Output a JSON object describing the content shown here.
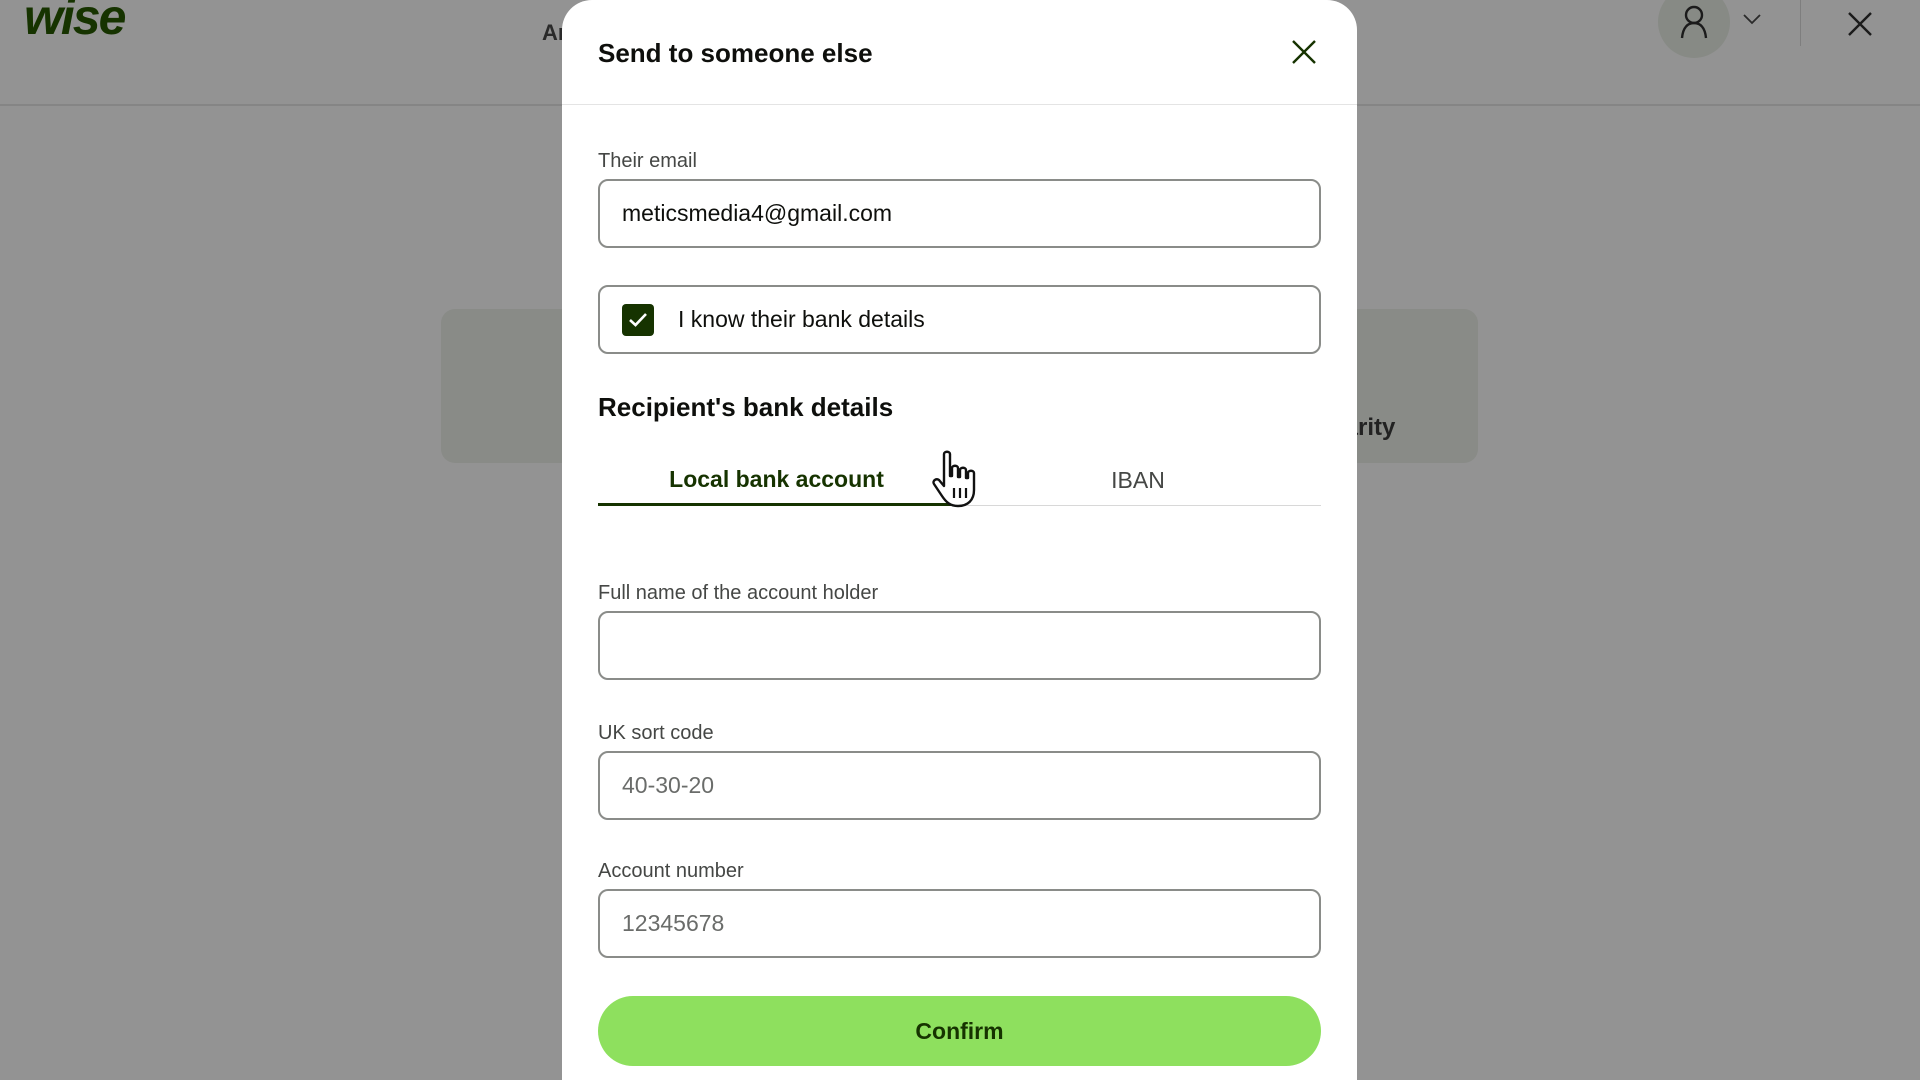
{
  "background": {
    "logo": "wise",
    "nav_partial": "Ar",
    "card_partial": "harity",
    "icons": [
      "user-icon",
      "chevron-down-icon",
      "close-icon"
    ]
  },
  "modal": {
    "title": "Send to someone else",
    "email": {
      "label": "Their email",
      "value": "meticsmedia4@gmail.com"
    },
    "bank_checkbox": {
      "label": "I know their bank details",
      "checked": true
    },
    "section_title": "Recipient's bank details",
    "tabs": [
      {
        "label": "Local bank account",
        "active": true
      },
      {
        "label": "IBAN",
        "active": false
      }
    ],
    "full_name": {
      "label": "Full name of the account holder",
      "value": "",
      "placeholder": ""
    },
    "sort_code": {
      "label": "UK sort code",
      "placeholder": "40-30-20"
    },
    "account_number": {
      "label": "Account number",
      "placeholder": "12345678"
    },
    "confirm_label": "Confirm"
  },
  "colors": {
    "accent": "#9fe870",
    "brand_dark": "#163300",
    "overlay": "#939393"
  }
}
